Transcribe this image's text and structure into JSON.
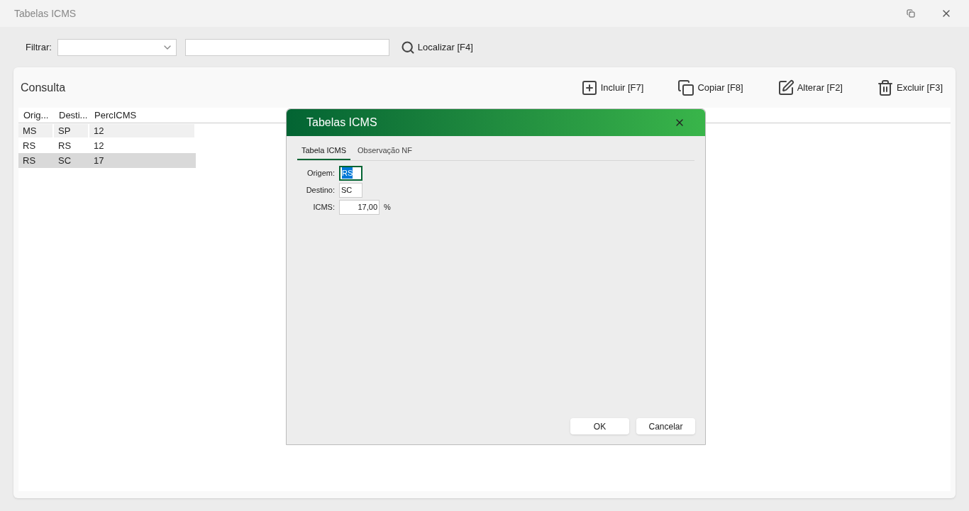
{
  "window": {
    "title": "Tabelas ICMS"
  },
  "filter": {
    "label": "Filtrar:",
    "search_button": "Localizar [F4]"
  },
  "panel": {
    "title": "Consulta",
    "actions": [
      {
        "kind": "add",
        "label": "Incluir [F7]"
      },
      {
        "kind": "copy",
        "label": "Copiar [F8]"
      },
      {
        "kind": "edit",
        "label": "Alterar [F2]"
      },
      {
        "kind": "delete",
        "label": "Excluir [F3]"
      }
    ]
  },
  "table": {
    "columns": [
      "Orig...",
      "Desti...",
      "PercICMS"
    ],
    "rows": [
      {
        "cells": [
          "MS",
          "SP",
          "12"
        ],
        "selected": false
      },
      {
        "cells": [
          "RS",
          "RS",
          "12"
        ],
        "selected": false
      },
      {
        "cells": [
          "RS",
          "SC",
          "17"
        ],
        "selected": true
      }
    ]
  },
  "dialog": {
    "title": "Tabelas ICMS",
    "tabs": [
      {
        "label": "Tabela ICMS",
        "selected": true
      },
      {
        "label": "Observação NF",
        "selected": false
      }
    ],
    "fields": [
      {
        "label": "Origem:",
        "value": "RS",
        "focused": true
      },
      {
        "label": "Destino:",
        "value": "SC",
        "focused": false
      },
      {
        "label": "ICMS:",
        "value": "17,00",
        "unit": "%",
        "focused": false
      }
    ],
    "buttons": [
      "OK",
      "Cancelar"
    ]
  }
}
